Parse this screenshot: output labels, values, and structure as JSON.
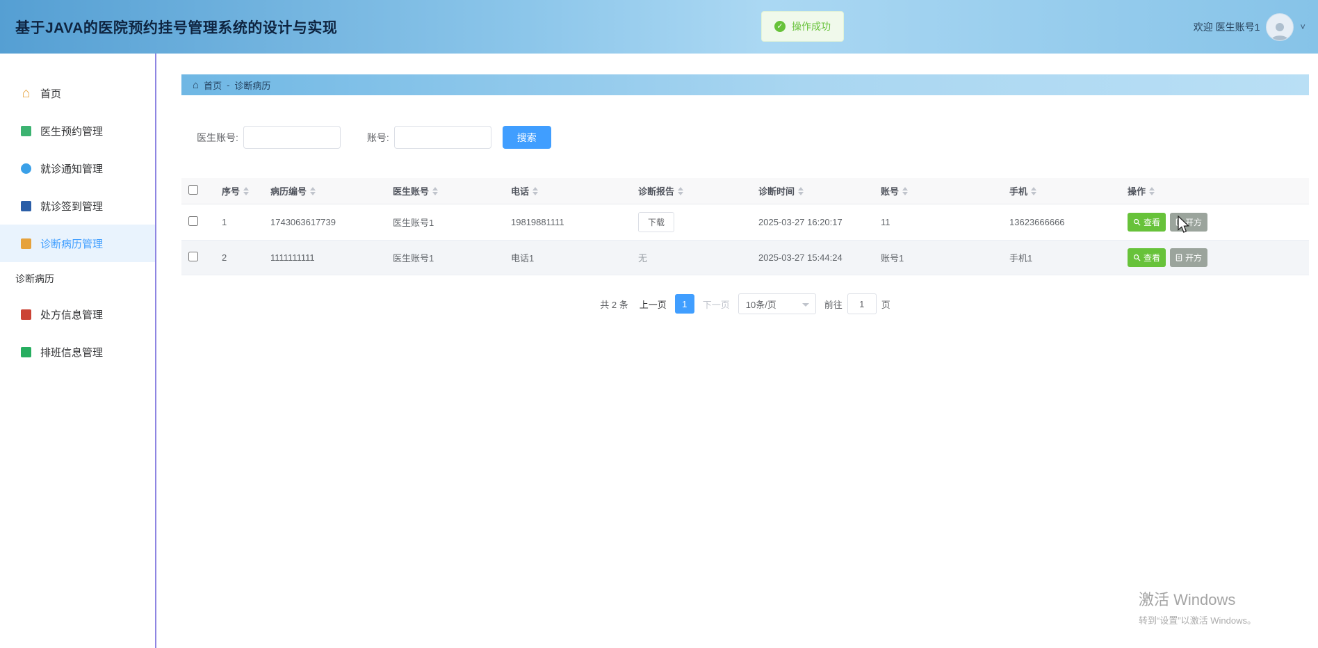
{
  "header": {
    "title": "基于JAVA的医院预约挂号管理系统的设计与实现",
    "toast": "操作成功",
    "welcome": "欢迎 医生账号1"
  },
  "icons": {
    "check": "✓",
    "home": "⌂",
    "breadcrumb_home": "⌂",
    "chevron_down": "˅"
  },
  "sidebar": {
    "items": [
      {
        "label": "首页"
      },
      {
        "label": "医生预约管理"
      },
      {
        "label": "就诊通知管理"
      },
      {
        "label": "就诊签到管理"
      },
      {
        "label": "诊断病历管理"
      },
      {
        "label": "处方信息管理"
      },
      {
        "label": "排班信息管理"
      }
    ],
    "subitem": "诊断病历"
  },
  "breadcrumb": {
    "home": "首页",
    "separator": "-",
    "current": "诊断病历"
  },
  "search": {
    "doctor_account_label": "医生账号:",
    "account_label": "账号:",
    "search_button": "搜索"
  },
  "table": {
    "headers": [
      "序号",
      "病历编号",
      "医生账号",
      "电话",
      "诊断报告",
      "诊断时间",
      "账号",
      "手机",
      "操作"
    ],
    "rows": [
      {
        "index": "1",
        "record_no": "1743063617739",
        "doctor_account": "医生账号1",
        "phone": "19819881111",
        "report": "下载",
        "time": "2025-03-27 16:20:17",
        "account": "11",
        "mobile": "13623666666"
      },
      {
        "index": "2",
        "record_no": "1111111111",
        "doctor_account": "医生账号1",
        "phone": "电话1",
        "report": "无",
        "time": "2025-03-27 15:44:24",
        "account": "账号1",
        "mobile": "手机1"
      }
    ],
    "view_button": "查看",
    "prescribe_button": "开方"
  },
  "pagination": {
    "total": "共 2 条",
    "prev": "上一页",
    "current_page": "1",
    "next": "下一页",
    "per_page": "10条/页",
    "goto_label": "前往",
    "goto_value": "1",
    "page_unit": "页"
  },
  "watermark": {
    "line1": "激活 Windows",
    "line2": "转到“设置”以激活 Windows。"
  },
  "colors": {
    "accent": "#409eff",
    "success": "#67c23a",
    "prescribe_gray": "#9ba49c",
    "sidebar_divider": "#8e85e2",
    "toast_bg": "#f0f9eb"
  }
}
